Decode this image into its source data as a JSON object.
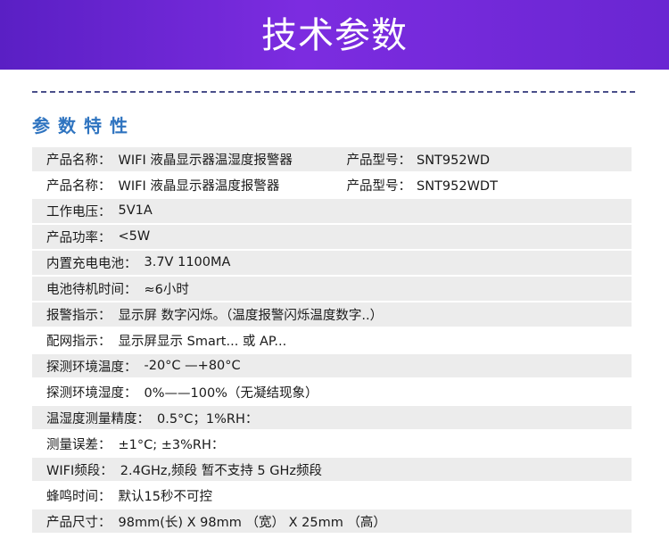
{
  "header": {
    "title": "技术参数"
  },
  "section": {
    "title": "参数特性"
  },
  "rows": {
    "r0": {
      "label": "产品名称：",
      "value": "WIFI 液晶显示器温湿度报警器",
      "model_label": "产品型号：",
      "model_value": "SNT952WD"
    },
    "r1": {
      "label": "产品名称：",
      "value": "WIFI 液晶显示器温度报警器",
      "model_label": "产品型号：",
      "model_value": "SNT952WDT"
    },
    "r2": {
      "label": "工作电压：",
      "value": "5V1A"
    },
    "r3": {
      "label": "产品功率：",
      "value": "<5W"
    },
    "r4": {
      "label": "内置充电电池：",
      "value": "3.7V 1100MA"
    },
    "r5": {
      "label": "电池待机时间：",
      "value": "≈6小时"
    },
    "r6": {
      "label": "报警指示：",
      "value": "显示屏 数字闪烁。（温度报警闪烁温度数字..）"
    },
    "r7": {
      "label": "配网指示：",
      "value": "显示屏显示 Smart... 或  AP..."
    },
    "r8": {
      "label": "探测环境温度：",
      "value": "-20°C —+80°C"
    },
    "r9": {
      "label": "探测环境湿度：",
      "value": "0%——100%（无凝结现象）"
    },
    "r10": {
      "label": "温湿度测量精度：",
      "value": "0.5°C；1%RH："
    },
    "r11": {
      "label": "测量误差：",
      "value": "±1°C;  ±3%RH："
    },
    "r12": {
      "label": "WIFI频段：",
      "value": "2.4GHz,频段 暂不支持 5 GHz频段"
    },
    "r13": {
      "label": "蜂鸣时间：",
      "value": "默认15秒不可控"
    },
    "r14": {
      "label": "产品尺寸：",
      "value": "98mm(长)  X  98mm （宽）  X  25mm （高）"
    }
  },
  "colors": {
    "banner": "#6a26d2",
    "section_title": "#2f74c0",
    "row_bg": "#ececec"
  }
}
